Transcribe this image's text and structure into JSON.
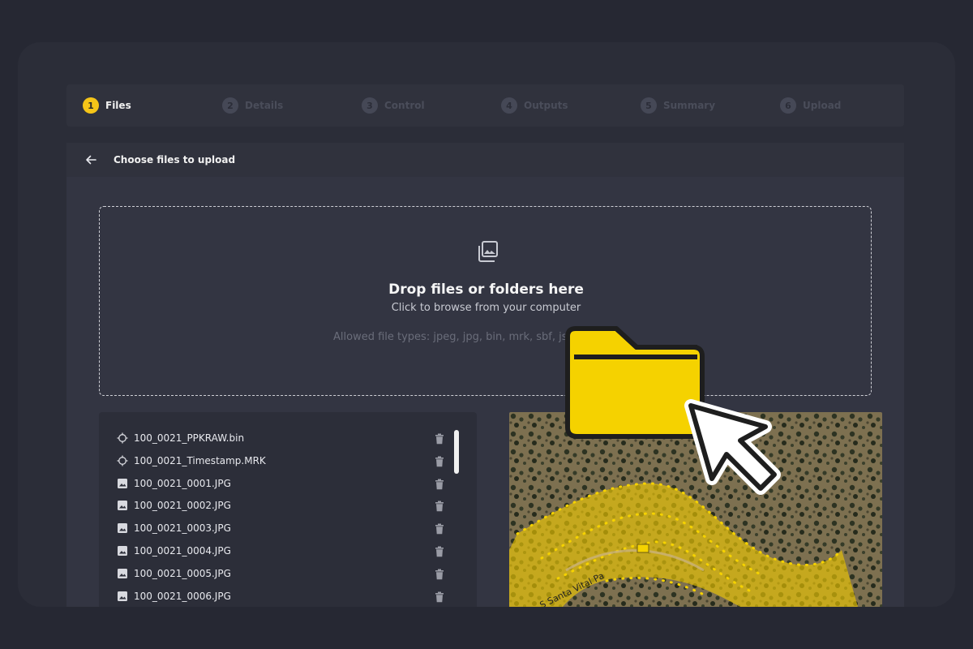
{
  "steps": [
    {
      "num": "1",
      "label": "Files"
    },
    {
      "num": "2",
      "label": "Details"
    },
    {
      "num": "3",
      "label": "Control"
    },
    {
      "num": "4",
      "label": "Outputs"
    },
    {
      "num": "5",
      "label": "Summary"
    },
    {
      "num": "6",
      "label": "Upload"
    }
  ],
  "panel": {
    "title": "Choose files to upload",
    "back_icon": "arrow-left-icon"
  },
  "dropzone": {
    "icon": "image-stack-icon",
    "title": "Drop files or folders here",
    "subtitle": "Click to browse from your computer",
    "allowed": "Allowed file types: jpeg, jpg, bin, mrk, sbf, js"
  },
  "files": [
    {
      "name": "100_0021_PPKRAW.bin",
      "icon": "crosshair-icon"
    },
    {
      "name": "100_0021_Timestamp.MRK",
      "icon": "crosshair-icon"
    },
    {
      "name": "100_0021_0001.JPG",
      "icon": "image-icon"
    },
    {
      "name": "100_0021_0002.JPG",
      "icon": "image-icon"
    },
    {
      "name": "100_0021_0003.JPG",
      "icon": "image-icon"
    },
    {
      "name": "100_0021_0004.JPG",
      "icon": "image-icon"
    },
    {
      "name": "100_0021_0005.JPG",
      "icon": "image-icon"
    },
    {
      "name": "100_0021_0006.JPG",
      "icon": "image-icon"
    }
  ],
  "map": {
    "road_label": "S Santa Vital Pa"
  },
  "colors": {
    "accent": "#f5c518",
    "overlay_yellow": "#f2cc00",
    "background": "#262833"
  }
}
